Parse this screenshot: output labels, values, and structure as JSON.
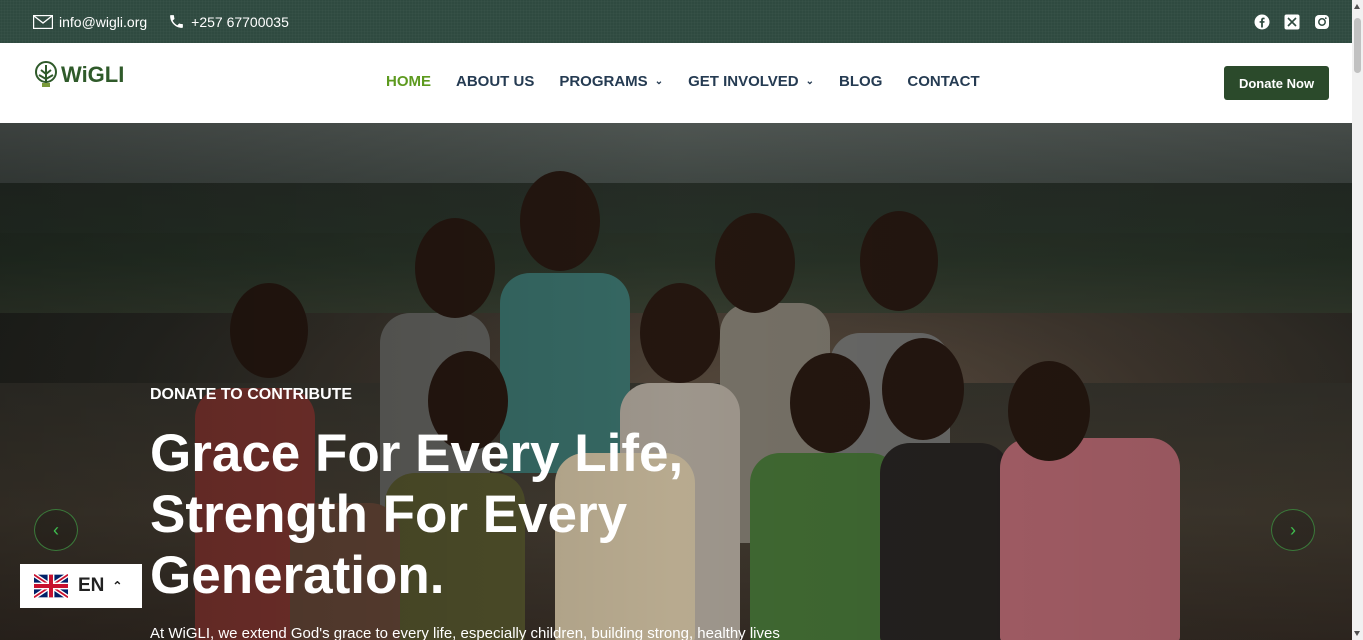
{
  "topbar": {
    "email": "info@wigli.org",
    "phone": "+257 67700035",
    "socials": [
      "facebook-icon",
      "x-icon",
      "instagram-icon"
    ]
  },
  "header": {
    "logo_text": "WiGLI",
    "nav": [
      {
        "label": "HOME",
        "active": true,
        "dropdown": false
      },
      {
        "label": "ABOUT US",
        "active": false,
        "dropdown": false
      },
      {
        "label": "PROGRAMS",
        "active": false,
        "dropdown": true
      },
      {
        "label": "GET INVOLVED",
        "active": false,
        "dropdown": true
      },
      {
        "label": "BLOG",
        "active": false,
        "dropdown": false
      },
      {
        "label": "CONTACT",
        "active": false,
        "dropdown": false
      }
    ],
    "donate_label": "Donate Now"
  },
  "hero": {
    "eyebrow": "DONATE TO CONTRIBUTE",
    "headline_lines": [
      "Grace For Every Life,",
      "Strength For Every",
      "Generation."
    ],
    "subtext": "At WiGLI, we extend God's grace to every life, especially children, building strong, healthy lives",
    "prev_label": "‹",
    "next_label": "›"
  },
  "language": {
    "code": "EN",
    "flag": "uk-flag-icon"
  },
  "colors": {
    "topbar_bg": "#2f4a40",
    "nav_text": "#253b52",
    "nav_active": "#5d9a1f",
    "donate_bg": "#2b4a2b",
    "arrow_accent": "#3fbf4f"
  }
}
